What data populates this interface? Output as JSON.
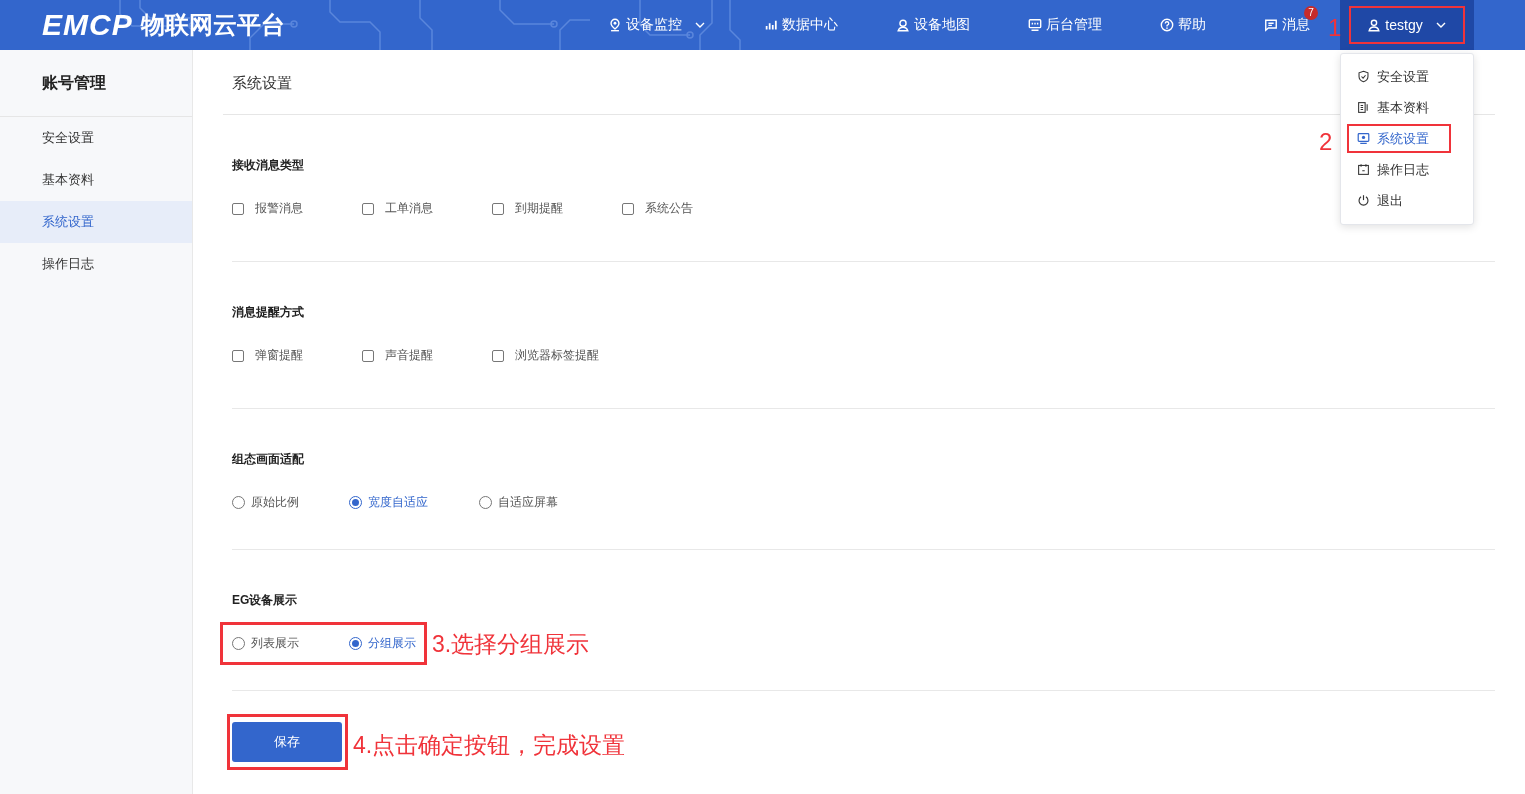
{
  "header": {
    "logo_mark": "EMCP",
    "logo_text": "物联网云平台",
    "nav": [
      {
        "label": "设备监控",
        "dropdown": true
      },
      {
        "label": "数据中心",
        "dropdown": false
      },
      {
        "label": "设备地图",
        "dropdown": false
      },
      {
        "label": "后台管理",
        "dropdown": false
      },
      {
        "label": "帮助",
        "dropdown": false
      },
      {
        "label": "消息",
        "dropdown": false,
        "badge": "7"
      }
    ],
    "user": {
      "name": "testgy",
      "annotation": "1"
    }
  },
  "user_menu": {
    "items": [
      {
        "label": "安全设置",
        "selected": false
      },
      {
        "label": "基本资料",
        "selected": false
      },
      {
        "label": "系统设置",
        "selected": true,
        "annotation": "2"
      },
      {
        "label": "操作日志",
        "selected": false
      },
      {
        "label": "退出",
        "selected": false
      }
    ]
  },
  "sidebar": {
    "title": "账号管理",
    "items": [
      {
        "label": "安全设置",
        "selected": false
      },
      {
        "label": "基本资料",
        "selected": false
      },
      {
        "label": "系统设置",
        "selected": true
      },
      {
        "label": "操作日志",
        "selected": false
      }
    ]
  },
  "page_title": "系统设置",
  "sections": [
    {
      "title": "接收消息类型",
      "kind": "checkbox",
      "options": [
        {
          "label": "报警消息",
          "checked": false
        },
        {
          "label": "工单消息",
          "checked": false
        },
        {
          "label": "到期提醒",
          "checked": false
        },
        {
          "label": "系统公告",
          "checked": false
        }
      ]
    },
    {
      "title": "消息提醒方式",
      "kind": "checkbox",
      "options": [
        {
          "label": "弹窗提醒",
          "checked": false
        },
        {
          "label": "声音提醒",
          "checked": false
        },
        {
          "label": "浏览器标签提醒",
          "checked": false
        }
      ]
    },
    {
      "title": "组态画面适配",
      "kind": "radio",
      "options": [
        {
          "label": "原始比例",
          "selected": false
        },
        {
          "label": "宽度自适应",
          "selected": true
        },
        {
          "label": "自适应屏幕",
          "selected": false
        }
      ]
    },
    {
      "title": "EG设备展示",
      "kind": "radio",
      "annotation": "3.选择分组展示",
      "options": [
        {
          "label": "列表展示",
          "selected": false
        },
        {
          "label": "分组展示",
          "selected": true
        }
      ]
    }
  ],
  "save": {
    "label": "保存",
    "annotation": "4.点击确定按钮，完成设置"
  }
}
